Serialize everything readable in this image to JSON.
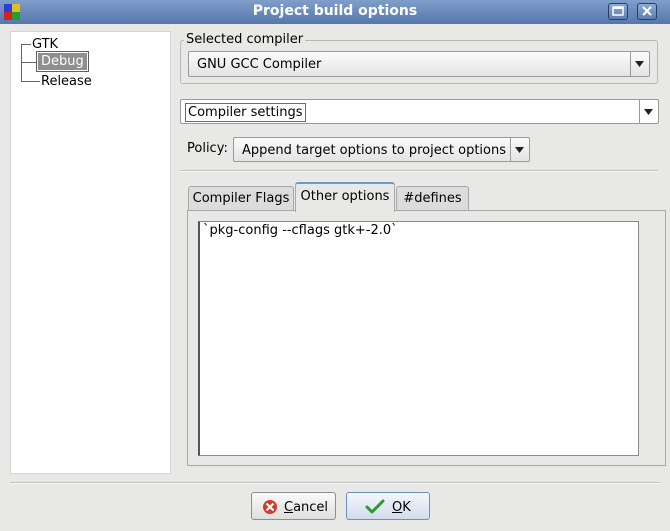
{
  "window": {
    "title": "Project build options"
  },
  "tree": {
    "root": "GTK",
    "children": [
      "Debug",
      "Release"
    ],
    "selected": "Debug"
  },
  "compiler": {
    "legend": "Selected compiler",
    "value": "GNU GCC Compiler"
  },
  "settings": {
    "value": "Compiler settings"
  },
  "policy": {
    "label": "Policy:",
    "value": "Append target options to project options"
  },
  "tabs": [
    {
      "label": "Compiler Flags",
      "active": false
    },
    {
      "label": "Other options",
      "active": true
    },
    {
      "label": "#defines",
      "active": false
    }
  ],
  "editor": {
    "content": "`pkg-config --cflags gtk+-2.0`"
  },
  "buttons": {
    "cancel": {
      "mnemonic": "C",
      "rest": "ancel"
    },
    "ok": {
      "mnemonic": "O",
      "rest": "K"
    }
  },
  "colors": {
    "titlebar": "#5577ab",
    "accent_green": "#3a8a3a"
  }
}
